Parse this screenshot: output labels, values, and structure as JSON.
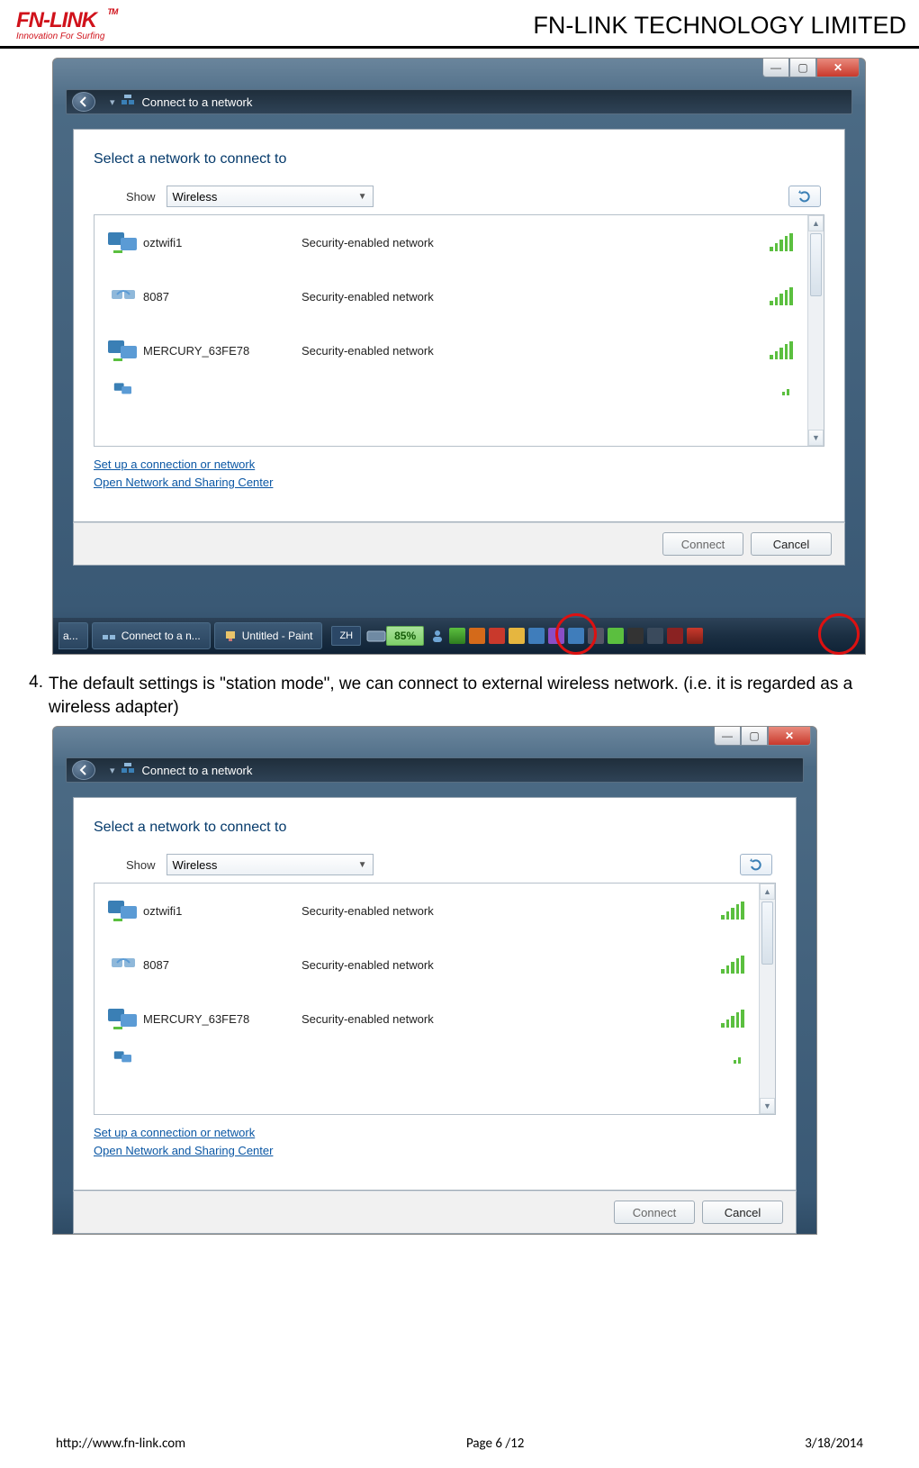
{
  "header": {
    "logo_main": "FN-LINK",
    "logo_tm": "TM",
    "logo_sub": "Innovation For Surfing",
    "company": "FN-LINK TECHNOLOGY LIMITED"
  },
  "step": {
    "num": "4.",
    "text": "The default settings is \"station mode\", we can connect to external wireless network. (i.e. it is regarded as a wireless adapter)"
  },
  "dialog": {
    "addr_title": "Connect to a network",
    "heading": "Select a network to connect to",
    "show_label": "Show",
    "show_value": "Wireless",
    "networks": [
      {
        "name": "oztwifi1",
        "security": "Security-enabled network",
        "icon": "pc"
      },
      {
        "name": "8087",
        "security": "Security-enabled network",
        "icon": "adhoc"
      },
      {
        "name": "MERCURY_63FE78",
        "security": "Security-enabled network",
        "icon": "pc"
      }
    ],
    "link1": "Set up a connection or network",
    "link2": "Open Network and Sharing Center",
    "btn_connect": "Connect",
    "btn_cancel": "Cancel"
  },
  "taskbar": {
    "item_left": "a...",
    "item_connect": "Connect to a n...",
    "item_paint": "Untitled - Paint",
    "lang": "ZH",
    "battery": "85%"
  },
  "titlebar": {
    "min": "—",
    "max": "▢",
    "close": "✕"
  },
  "footer": {
    "url": "http://www.fn-link.com",
    "page": "Page 6 /12",
    "date": "3/18/2014"
  }
}
